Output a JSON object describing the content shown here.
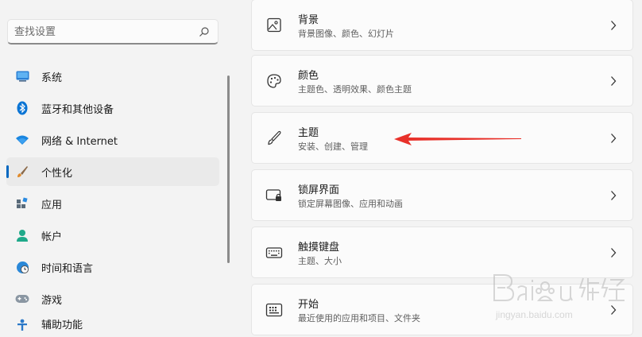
{
  "search": {
    "placeholder": "查找设置",
    "value": ""
  },
  "sidebar": {
    "items": [
      {
        "label": "系统",
        "icon": "monitor-icon"
      },
      {
        "label": "蓝牙和其他设备",
        "icon": "bluetooth-icon"
      },
      {
        "label": "网络 & Internet",
        "icon": "wifi-icon"
      },
      {
        "label": "个性化",
        "icon": "paintbrush-icon",
        "active": true
      },
      {
        "label": "应用",
        "icon": "apps-icon"
      },
      {
        "label": "帐户",
        "icon": "person-icon"
      },
      {
        "label": "时间和语言",
        "icon": "globe-clock-icon"
      },
      {
        "label": "游戏",
        "icon": "gamepad-icon"
      },
      {
        "label": "辅助功能",
        "icon": "accessibility-icon"
      }
    ]
  },
  "cards": [
    {
      "title": "背景",
      "subtitle": "背景图像、颜色、幻灯片",
      "icon": "image-icon"
    },
    {
      "title": "颜色",
      "subtitle": "主题色、透明效果、颜色主题",
      "icon": "palette-icon"
    },
    {
      "title": "主题",
      "subtitle": "安装、创建、管理",
      "icon": "brush-icon"
    },
    {
      "title": "锁屏界面",
      "subtitle": "锁定屏幕图像、应用和动画",
      "icon": "lock-screen-icon"
    },
    {
      "title": "触摸键盘",
      "subtitle": "主题、大小",
      "icon": "keyboard-icon"
    },
    {
      "title": "开始",
      "subtitle": "最近使用的应用和项目、文件夹",
      "icon": "start-icon"
    }
  ],
  "colors": {
    "accent": "#0067c0",
    "annotation": "#e8312a"
  }
}
